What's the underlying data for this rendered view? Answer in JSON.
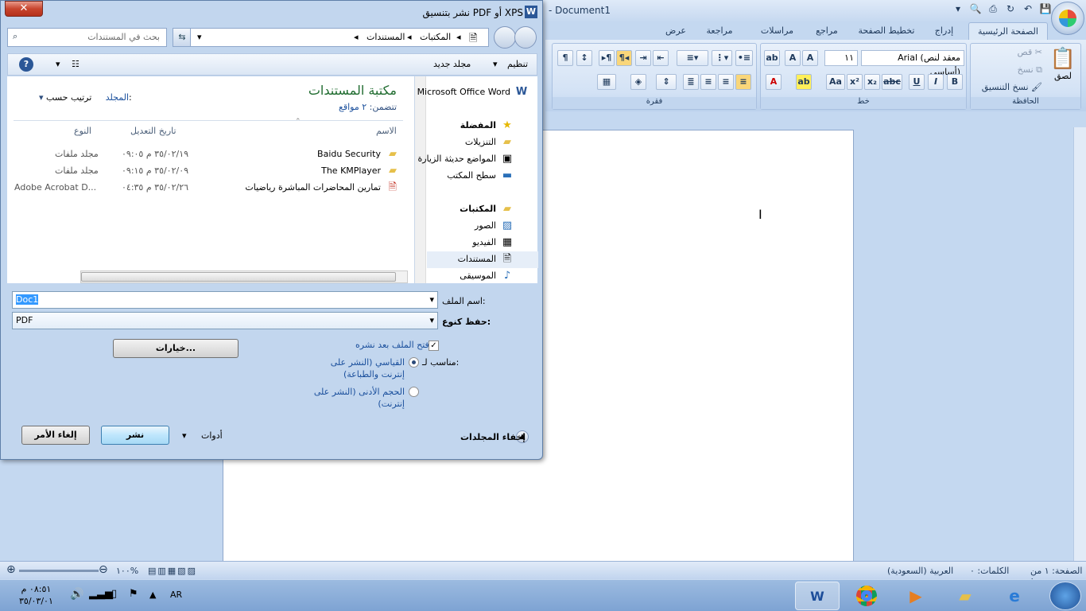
{
  "word": {
    "title": "- Document1",
    "tabs": [
      "عرض",
      "مراجعة",
      "مراسلات",
      "مراجع",
      "تخطيط الصفحة",
      "إدراج",
      "الصفحة الرئيسية"
    ],
    "active_tab": "الصفحة الرئيسية",
    "clipboard": {
      "paste": "لصق",
      "cut": "قص",
      "copy": "نسخ",
      "format_painter": "نسخ التنسيق",
      "label": "الحافظة"
    },
    "font": {
      "name": "Arial (معقد لنص أساسي)",
      "size": "١١",
      "label": "خط"
    },
    "paragraph_label": "فقرة",
    "status": {
      "page": "الصفحة: ١ من ١",
      "words": "الكلمات: ٠",
      "language": "العربية (السعودية)",
      "zoom": "١٠٠%"
    },
    "doc_cursor": "I"
  },
  "dialog": {
    "title": "نشر بتنسيق PDF أو XPS",
    "close": "✕",
    "breadcrumb": [
      "المكتبات",
      "المستندات"
    ],
    "search_placeholder": "بحث في المستندات",
    "toolbar": {
      "organize": "تنظيم",
      "new_folder": "مجلد جديد"
    },
    "nav": {
      "word_root": "Microsoft Office Word",
      "favorites": "المفضلة",
      "downloads": "التنزيلات",
      "recent": "المواضع حديثة الزيارة",
      "desktop": "سطح المكتب",
      "libraries": "المكتبات",
      "pictures": "الصور",
      "videos": "الفيديو",
      "documents": "المستندات",
      "music": "الموسيقى"
    },
    "library": {
      "title": "مكتبة المستندات",
      "subtitle_label": "تتضمن:",
      "subtitle_value": "٢ مواقع",
      "sort_label": "ترتيب حسب:",
      "sort_value": "المجلد"
    },
    "columns": {
      "name": "الاسم",
      "modified": "تاريخ التعديل",
      "type": "النوع"
    },
    "files": [
      {
        "name": "Baidu Security",
        "modified": "٣٥/٠٢/١٩ م ٠٩:٠٥",
        "type": "مجلد ملفات",
        "icon": "folder-icon"
      },
      {
        "name": "The KMPlayer",
        "modified": "٣٥/٠٢/٠٩ م ٠٩:١٥",
        "type": "مجلد ملفات",
        "icon": "folder-icon"
      },
      {
        "name": "تمارين المحاضرات المباشرة رياضيات",
        "modified": "٣٥/٠٢/٢٦ م ٠٤:٣٥",
        "type": "Adobe Acrobat D...",
        "icon": "pdf-icon"
      }
    ],
    "filename_label": "اسم الملف:",
    "filename_value": "Doc1",
    "savetype_label": "حفظ كنوع:",
    "savetype_value": "PDF",
    "options_button": "خيارات...",
    "open_after": "فتح الملف بعد نشره",
    "open_after_checked": true,
    "optimize_label": "مناسب لـ:",
    "opt_standard": "القياسي (النشر على إنترنت والطباعة)",
    "opt_minimum": "الحجم الأدنى (النشر على إنترنت)",
    "hide_folders": "إخفاء المجلدات",
    "tools": "أدوات",
    "publish": "نشر",
    "cancel": "إلغاء الأمر"
  },
  "taskbar": {
    "lang": "AR",
    "time": "٠٨:٥١ م",
    "date": "٣٥/٠٣/٠١"
  }
}
